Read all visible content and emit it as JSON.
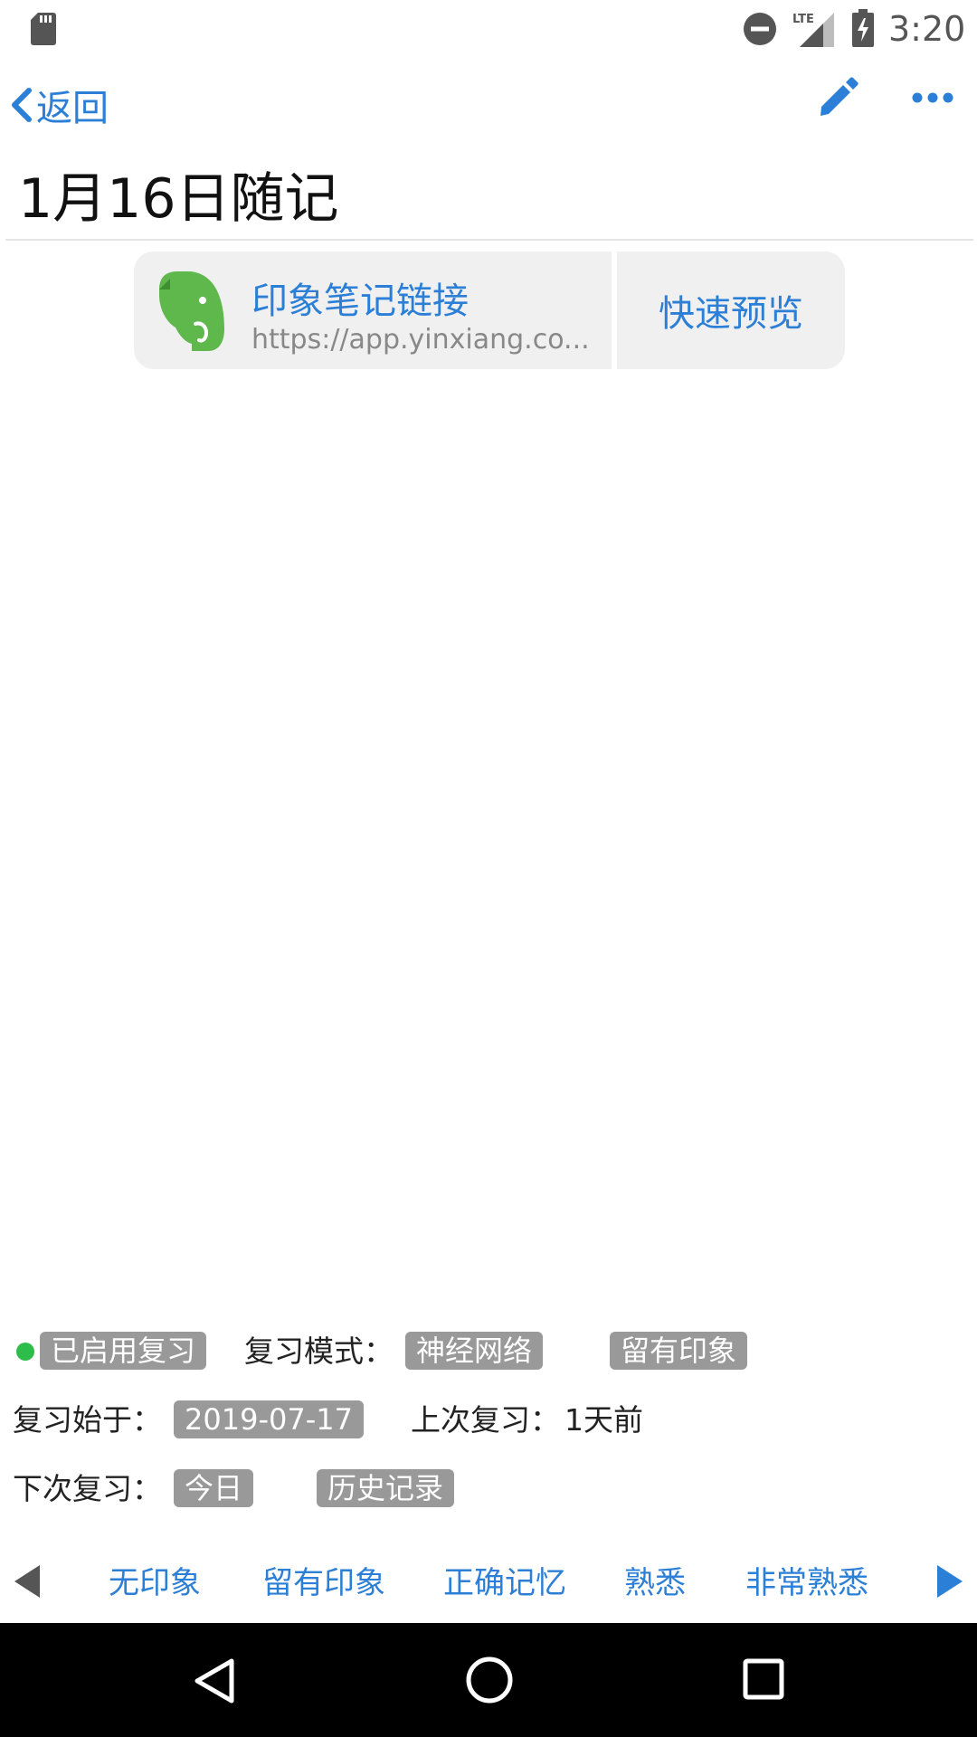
{
  "status_bar": {
    "time": "3:20",
    "network": "LTE",
    "icons": [
      "sd-card-icon",
      "do-not-disturb-icon",
      "lte-signal-icon",
      "battery-charging-icon"
    ]
  },
  "header": {
    "back_label": "返回",
    "title": "1月16日随记",
    "icons": [
      "chevron-left-icon",
      "pencil-icon",
      "more-horizontal-icon"
    ]
  },
  "link_card": {
    "title": "印象笔记链接",
    "url": "https://app.yinxiang.co...",
    "preview_label": "快速预览",
    "icon": "evernote-elephant-icon"
  },
  "review": {
    "enabled_label": "已启用复习",
    "mode_label": "复习模式：",
    "mode_value": "神经网络",
    "level_value": "留有印象",
    "start_label": "复习始于：",
    "start_value": "2019-07-17",
    "last_label": "上次复习：",
    "last_value": "1天前",
    "next_label": "下次复习：",
    "next_value": "今日",
    "history_label": "历史记录"
  },
  "rating_bar": {
    "options": [
      "无印象",
      "留有印象",
      "正确记忆",
      "熟悉",
      "非常熟悉"
    ]
  },
  "colors": {
    "accent": "#2c7fd6",
    "chip": "#999999",
    "enabled_dot": "#2ebd4a",
    "evernote_green": "#5fb84b",
    "card_bg": "#f0f0f0"
  }
}
